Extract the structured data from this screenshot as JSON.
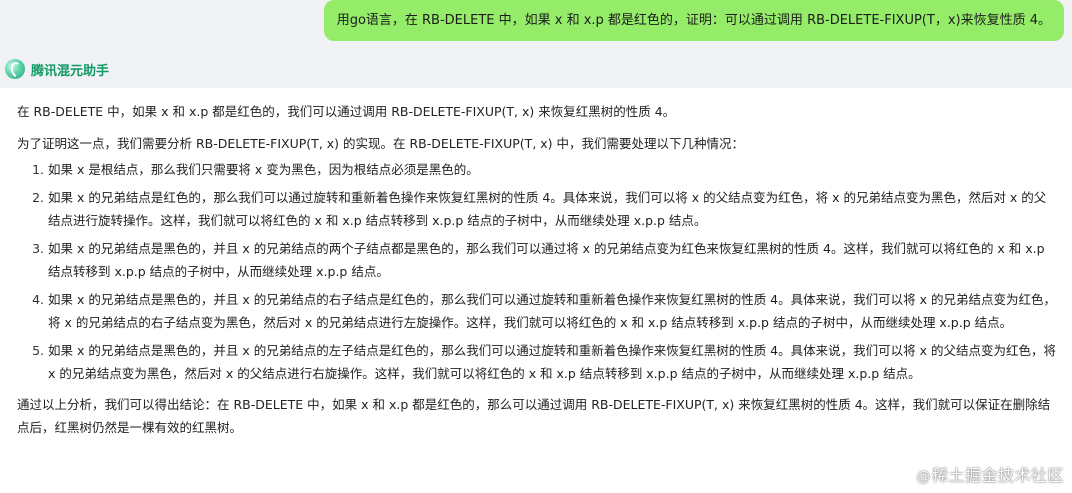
{
  "user_message": "用go语言，在 RB-DELETE 中，如果 x 和 x.p 都是红色的，证明：可以通过调用 RB-DELETE-FIXUP(T，x)来恢复性质 4。",
  "assistant": {
    "name": "腾讯混元助手",
    "intro": "在 RB-DELETE 中，如果 x 和 x.p 都是红色的，我们可以通过调用 RB-DELETE-FIXUP(T, x) 来恢复红黑树的性质 4。",
    "lead": "为了证明这一点，我们需要分析 RB-DELETE-FIXUP(T, x) 的实现。在 RB-DELETE-FIXUP(T, x) 中，我们需要处理以下几种情况：",
    "cases": [
      "如果 x 是根结点，那么我们只需要将 x 变为黑色，因为根结点必须是黑色的。",
      "如果 x 的兄弟结点是红色的，那么我们可以通过旋转和重新着色操作来恢复红黑树的性质 4。具体来说，我们可以将 x 的父结点变为红色，将 x 的兄弟结点变为黑色，然后对 x 的父结点进行旋转操作。这样，我们就可以将红色的 x 和 x.p 结点转移到 x.p.p 结点的子树中，从而继续处理 x.p.p 结点。",
      "如果 x 的兄弟结点是黑色的，并且 x 的兄弟结点的两个子结点都是黑色的，那么我们可以通过将 x 的兄弟结点变为红色来恢复红黑树的性质 4。这样，我们就可以将红色的 x 和 x.p 结点转移到 x.p.p 结点的子树中，从而继续处理 x.p.p 结点。",
      "如果 x 的兄弟结点是黑色的，并且 x 的兄弟结点的右子结点是红色的，那么我们可以通过旋转和重新着色操作来恢复红黑树的性质 4。具体来说，我们可以将 x 的兄弟结点变为红色，将 x 的兄弟结点的右子结点变为黑色，然后对 x 的兄弟结点进行左旋操作。这样，我们就可以将红色的 x 和 x.p 结点转移到 x.p.p 结点的子树中，从而继续处理 x.p.p 结点。",
      "如果 x 的兄弟结点是黑色的，并且 x 的兄弟结点的左子结点是红色的，那么我们可以通过旋转和重新着色操作来恢复红黑树的性质 4。具体来说，我们可以将 x 的父结点变为红色，将 x 的兄弟结点变为黑色，然后对 x 的父结点进行右旋操作。这样，我们就可以将红色的 x 和 x.p 结点转移到 x.p.p 结点的子树中，从而继续处理 x.p.p 结点。"
    ],
    "conclusion": "通过以上分析，我们可以得出结论：在 RB-DELETE 中，如果 x 和 x.p 都是红色的，那么可以通过调用 RB-DELETE-FIXUP(T, x) 来恢复红黑树的性质 4。这样，我们就可以保证在删除结点后，红黑树仍然是一棵有效的红黑树。"
  },
  "watermark": {
    "at": "@",
    "text": "稀土掘金技术社区"
  },
  "colors": {
    "page_background": "#f1f2f6",
    "user_bubble": "#95ec69",
    "assistant_name": "#119964",
    "card_background": "#ffffff"
  },
  "icons": {
    "assistant_logo": "hunyuan-logo-icon"
  }
}
